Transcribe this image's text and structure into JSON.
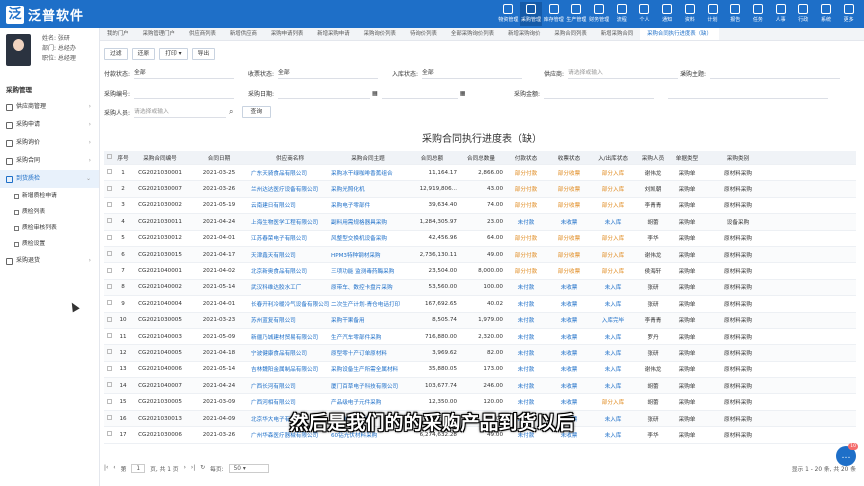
{
  "app": {
    "logo_mark": "泛",
    "name": "泛普软件"
  },
  "nav": [
    "物资管理",
    "采购管理",
    "库存管理",
    "生产管理",
    "财务管理",
    "流程",
    "个人",
    "通知",
    "资料",
    "计划",
    "报告",
    "任务",
    "人事",
    "行政",
    "系统",
    "更多"
  ],
  "nav_active": 1,
  "user": {
    "name": "姓名: 张研",
    "dept": "部门: 总经办",
    "role": "职位: 总经理"
  },
  "sidebar": {
    "title": "采购管理",
    "items": [
      {
        "label": "供应商管理",
        "icon": "supplier-icon",
        "arrow": "›"
      },
      {
        "label": "采购申请",
        "icon": "request-icon",
        "arrow": "›"
      },
      {
        "label": "采购询价",
        "icon": "inquiry-icon",
        "arrow": "›"
      },
      {
        "label": "采购合同",
        "icon": "contract-icon",
        "arrow": "›"
      },
      {
        "label": "到货质检",
        "icon": "inspection-icon",
        "arrow": "⌄"
      }
    ],
    "sub_items": [
      "新增质检申请",
      "质检列表",
      "质检审核列表",
      "质检设置"
    ],
    "last_item": {
      "label": "采购退货",
      "icon": "return-icon",
      "arrow": "›"
    }
  },
  "tabs": [
    "我的门户",
    "采购管理门户",
    "供应商列表",
    "新增供应商",
    "采购申请列表",
    "新增采购申请",
    "采购询价列表",
    "待询价列表",
    "全部采购询价列表",
    "新增采购询价",
    "采购合同列表",
    "新增采购合同",
    "采购合同执行进度表（缺）"
  ],
  "toolbar": {
    "b1": "过滤",
    "b2": "还原",
    "b3": "打印",
    "b3_arrow": "▾",
    "b4": "导出"
  },
  "filters": {
    "pay_status": {
      "label": "付款状态:",
      "value": "全部"
    },
    "invoice_status": {
      "label": "收票状态:",
      "value": "全部"
    },
    "stock_status": {
      "label": "入库状态:",
      "value": "全部"
    },
    "supplier": {
      "label": "供应商:",
      "placeholder": "请选择或输入"
    },
    "subject": {
      "label": "采购主题:",
      "value": ""
    },
    "code": {
      "label": "采购编号:",
      "value": ""
    },
    "date": {
      "label": "采购日期:",
      "value": ""
    },
    "date2": {
      "label": "",
      "value": ""
    },
    "amount": {
      "label": "采购金额:",
      "value": ""
    },
    "amount2": {
      "label": "",
      "value": ""
    },
    "person": {
      "label": "采购人员:",
      "placeholder": "请选择或输入"
    },
    "query": "查询"
  },
  "page_title": "采购合同执行进度表（缺）",
  "table": {
    "headers": [
      "序号",
      "采购合同编号",
      "合同日期",
      "供应商名称",
      "采购合同主题",
      "合同总额",
      "合同总数量",
      "付款状态",
      "收票状态",
      "入/出库状态",
      "采购人员",
      "单据类型",
      "采购类别"
    ],
    "rows": [
      [
        "1",
        "CG2021030001",
        "2021-03-25",
        "广东天骑食品有限公司",
        "采购冰干绿咖啡香蕉组合",
        "11,164.17",
        "2,866.00",
        "部分付款",
        "部分收票",
        "部分入库",
        "谢伟龙",
        "采购单",
        "原材料采购"
      ],
      [
        "2",
        "CG2021030007",
        "2021-03-26",
        "兰州达达医疗设备有限公司",
        "采购光照化机",
        "12,919,806...",
        "43.00",
        "部分付款",
        "部分收票",
        "部分入库",
        "刘凯朝",
        "采购单",
        "原材料采购"
      ],
      [
        "3",
        "CG2021030002",
        "2021-05-19",
        "云南建日有限公司",
        "采购电子零部件",
        "39,634.40",
        "74.00",
        "部分付款",
        "部分收票",
        "部分入库",
        "李青青",
        "采购单",
        "原材料采购"
      ],
      [
        "4",
        "CG2021030011",
        "2021-04-24",
        "上海生物医学工程有限公司",
        "副料用需规格器具采购",
        "1,284,305.97",
        "23.00",
        "未付款",
        "未收票",
        "未入库",
        "胡蕾",
        "采购单",
        "设备采购"
      ],
      [
        "5",
        "CG2021030012",
        "2021-04-01",
        "江苏春荣电子有限公司",
        "风整型交换机设备采购",
        "42,456.96",
        "64.00",
        "部分付款",
        "部分收票",
        "部分入库",
        "李华",
        "采购单",
        "原材料采购"
      ],
      [
        "6",
        "CG2021030015",
        "2021-04-17",
        "天津鑫天有限公司",
        "HPM3特种钢材采购",
        "2,736,130.11",
        "49.00",
        "部分付款",
        "部分收票",
        "部分入库",
        "谢伟龙",
        "采购单",
        "原材料采购"
      ],
      [
        "7",
        "CG2021040001",
        "2021-04-02",
        "北京新奥食品有限公司",
        "三项功能 监测毒药酶采购",
        "23,504.00",
        "8,000.00",
        "部分付款",
        "部分收票",
        "部分入库",
        "侯海轩",
        "采购单",
        "原材料采购"
      ],
      [
        "8",
        "CG2021040002",
        "2021-05-14",
        "武汉科维达胶水工厂",
        "原带车、数控卡盘片采购",
        "53,560.00",
        "100.00",
        "未付款",
        "未收票",
        "未入库",
        "张研",
        "采购单",
        "原材料采购"
      ],
      [
        "9",
        "CG2021040004",
        "2021-04-01",
        "长春开利冷暖冷气设备有限公司",
        "二次生产计划-青仓电话打印",
        "167,692.65",
        "40.02",
        "未付款",
        "未收票",
        "未入库",
        "张研",
        "采购单",
        "原材料采购"
      ],
      [
        "10",
        "CG2021030005",
        "2021-03-23",
        "苏州蓝复有限公司",
        "采购干果备用",
        "8,505.74",
        "1,979.00",
        "未付款",
        "未收票",
        "入库完毕",
        "李青青",
        "采购单",
        "原材料采购"
      ],
      [
        "11",
        "CG2021040003",
        "2021-05-09",
        "新疆乃城建材贸易有限公司",
        "生产汽车零部件采购",
        "716,880.00",
        "2,320.00",
        "未付款",
        "未收票",
        "未入库",
        "罗丹",
        "采购单",
        "原材料采购"
      ],
      [
        "12",
        "CG2021040005",
        "2021-04-18",
        "宁波健康食品有限公司",
        "原型零十产订单原材料",
        "3,969.62",
        "82.00",
        "未付款",
        "未收票",
        "未入库",
        "张研",
        "采购单",
        "原材料采购"
      ],
      [
        "13",
        "CG2021040006",
        "2021-05-14",
        "吉林魏阳金属制品有限公司",
        "采购设备生产所需全属材料",
        "35,880.05",
        "173.00",
        "未付款",
        "未收票",
        "未入库",
        "谢伟龙",
        "采购单",
        "原材料采购"
      ],
      [
        "14",
        "CG2021040007",
        "2021-04-24",
        "广西长河有限公司",
        "厦门百草电子科技有限公司",
        "103,677.74",
        "246.00",
        "未付款",
        "未收票",
        "未入库",
        "胡蕾",
        "采购单",
        "原材料采购"
      ],
      [
        "15",
        "CG2021030005",
        "2021-03-09",
        "广西河相有限公司",
        "产品级电子元件采购",
        "12,350.00",
        "120.00",
        "未付款",
        "未收票",
        "部分入库",
        "胡蕾",
        "采购单",
        "原材料采购"
      ],
      [
        "16",
        "CG2021030013",
        "2021-04-09",
        "北京华大电子有限公司",
        "采购电子零器具",
        "87,200.00",
        "62.00",
        "未付款",
        "未收票",
        "未入库",
        "张研",
        "采购单",
        "原材料采购"
      ],
      [
        "17",
        "CG2021030006",
        "2021-03-26",
        "广州华森医疗器械有限公司",
        "60钻光伏材料采购",
        "6,274,632.28",
        "49.00",
        "未付款",
        "未收票",
        "未入库",
        "李华",
        "采购单",
        "原材料采购"
      ]
    ]
  },
  "pager": {
    "first": "|‹",
    "prev": "‹",
    "page_pre": "第",
    "page": "1",
    "page_post": "页, 共 1 页",
    "next": "›",
    "last": "›|",
    "refresh": "↻",
    "per_label": "每页:",
    "per": "50",
    "per_arrow": "▾",
    "summary": "显示 1 - 20 条, 共 20 条"
  },
  "caption": "然后是我们的的采购产品到货以后",
  "chat_badge": "10",
  "chat_icon": "…",
  "colors": {
    "primary": "#1e6fc8",
    "orange": "#e08a1e"
  }
}
